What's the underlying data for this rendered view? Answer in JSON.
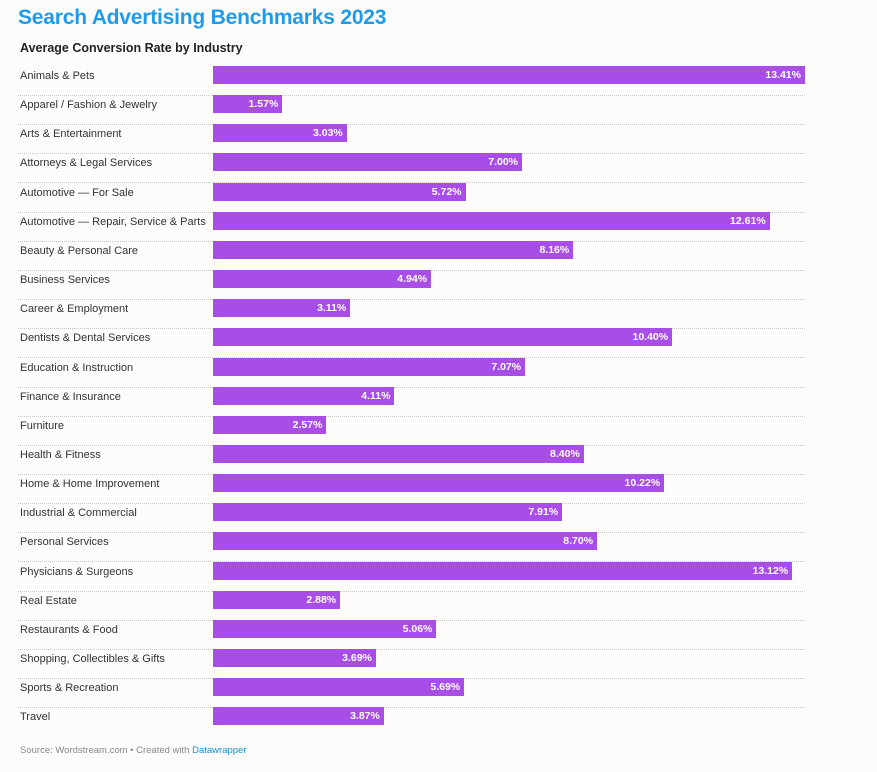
{
  "chart_data": {
    "type": "bar",
    "orientation": "horizontal",
    "title": "Search Advertising Benchmarks 2023",
    "subtitle": "Average Conversion Rate by Industry",
    "xlabel": "",
    "ylabel": "",
    "unit": "%",
    "xlim": [
      0,
      13.41
    ],
    "grid": false,
    "bar_color": "#a84ee6",
    "categories": [
      "Animals & Pets",
      "Apparel / Fashion & Jewelry",
      "Arts & Entertainment",
      "Attorneys & Legal Services",
      "Automotive — For Sale",
      "Automotive — Repair, Service & Parts",
      "Beauty & Personal Care",
      "Business Services",
      "Career & Employment",
      "Dentists & Dental Services",
      "Education & Instruction",
      "Finance & Insurance",
      "Furniture",
      "Health & Fitness",
      "Home & Home Improvement",
      "Industrial & Commercial",
      "Personal Services",
      "Physicians & Surgeons",
      "Real Estate",
      "Restaurants & Food",
      "Shopping, Collectibles & Gifts",
      "Sports & Recreation",
      "Travel"
    ],
    "values": [
      13.41,
      1.57,
      3.03,
      7.0,
      5.72,
      12.61,
      8.16,
      4.94,
      3.11,
      10.4,
      7.07,
      4.11,
      2.57,
      8.4,
      10.22,
      7.91,
      8.7,
      13.12,
      2.88,
      5.06,
      3.69,
      5.69,
      3.87
    ],
    "value_labels": [
      "13.41%",
      "1.57%",
      "3.03%",
      "7.00%",
      "5.72%",
      "12.61%",
      "8.16%",
      "4.94%",
      "3.11%",
      "10.40%",
      "7.07%",
      "4.11%",
      "2.57%",
      "8.40%",
      "10.22%",
      "7.91%",
      "8.70%",
      "13.12%",
      "2.88%",
      "5.06%",
      "3.69%",
      "5.69%",
      "3.87%"
    ]
  },
  "footer": {
    "source_text": "Source: Wordstream.com • Created with ",
    "link_text": "Datawrapper"
  },
  "colors": {
    "title": "#1e9bea",
    "bar": "#a84ee6",
    "link": "#1a8fd0"
  }
}
